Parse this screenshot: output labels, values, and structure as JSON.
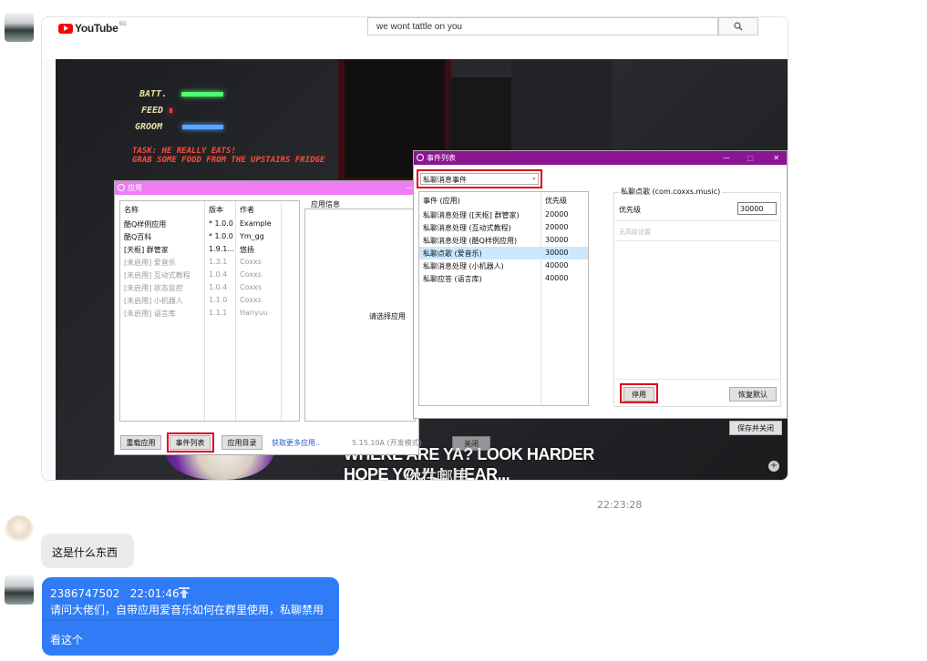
{
  "screenshot": {
    "youtube": {
      "logo_word": "YouTube",
      "region": "SG",
      "search_value": "we wont tattle on you"
    },
    "video": {
      "hud": [
        "BATT.",
        "FEED",
        "GROOM"
      ],
      "task_line1": "TASK: HE REALLY EATS!",
      "task_line2": "GRAB SOME FOOD FROM THE UPSTAIRS FRIDGE",
      "caption1": "WHERE ARE YA? LOOK HARDER",
      "caption2": "HOPE YOU'LL HEAR...",
      "subtitle_overlay": "你在哪里"
    },
    "app_window": {
      "title": "应用",
      "columns": [
        "名称",
        "版本",
        "作者"
      ],
      "rows": [
        {
          "name": "酷Q样例应用",
          "version": "* 1.0.0",
          "author": "Example",
          "disabled": false
        },
        {
          "name": "酷Q百科",
          "version": "* 1.0.0",
          "author": "Ym_gg",
          "disabled": false
        },
        {
          "name": "[天枢] 群管家",
          "version": "1.9.1...",
          "author": "悠扬",
          "disabled": false
        },
        {
          "name": "[未启用] 爱音乐",
          "version": "1.3.1",
          "author": "Coxxs",
          "disabled": true
        },
        {
          "name": "[未启用] 互动式教程",
          "version": "1.0.4",
          "author": "Coxxs",
          "disabled": true
        },
        {
          "name": "[未启用] 状态监控",
          "version": "1.0.4",
          "author": "Coxxs",
          "disabled": true
        },
        {
          "name": "[未启用] 小机器人",
          "version": "1.1.0",
          "author": "Coxxs",
          "disabled": true
        },
        {
          "name": "[未启用] 语言库",
          "version": "1.1.1",
          "author": "Hanyuu",
          "disabled": true
        }
      ],
      "info_header": "应用信息",
      "info_placeholder": "请选择应用",
      "buttons": {
        "reload": "重载应用",
        "event_list": "事件列表",
        "app_dir": "应用目录"
      },
      "more_link": "获取更多应用..",
      "version_text": "5.15.10A (开发模式)",
      "close_button": "关闭"
    },
    "event_window": {
      "title": "事件列表",
      "dropdown_value": "私聊消息事件",
      "columns": [
        "事件 (应用)",
        "优先级"
      ],
      "rows": [
        {
          "event": "私聊消息处理 ([天枢] 群管家)",
          "priority": "20000"
        },
        {
          "event": "私聊消息处理 (互动式教程)",
          "priority": "20000"
        },
        {
          "event": "私聊消息处理 (酷Q样例应用)",
          "priority": "30000"
        },
        {
          "event": "私聊点歌 (爱音乐)",
          "priority": "30000",
          "selected": true
        },
        {
          "event": "私聊消息处理 (小机器人)",
          "priority": "40000"
        },
        {
          "event": "私聊应答 (语言库)",
          "priority": "40000"
        }
      ],
      "detail_group_title": "私聊点歌 (com.coxxs.music)",
      "priority_label": "优先级",
      "priority_value": "30000",
      "advanced_placeholder": "无高级设置",
      "disable_button": "停用",
      "restore_button": "恢复默认",
      "save_close_button": "保存并关闭"
    }
  },
  "chat": {
    "timestamp": "22:23:28",
    "message1": "这是什么东西",
    "quote_header": "2386747502   22:01:46",
    "quote_text": "请问大佬们，自带应用爱音乐如何在群里使用，私聊禁用",
    "reply_text": "看这个"
  },
  "colors": {
    "accent_blue": "#2f7cf6",
    "event_title_purple": "#8b1592",
    "app_title_pink": "#ef7cf5",
    "highlight_red": "#e0001a"
  }
}
